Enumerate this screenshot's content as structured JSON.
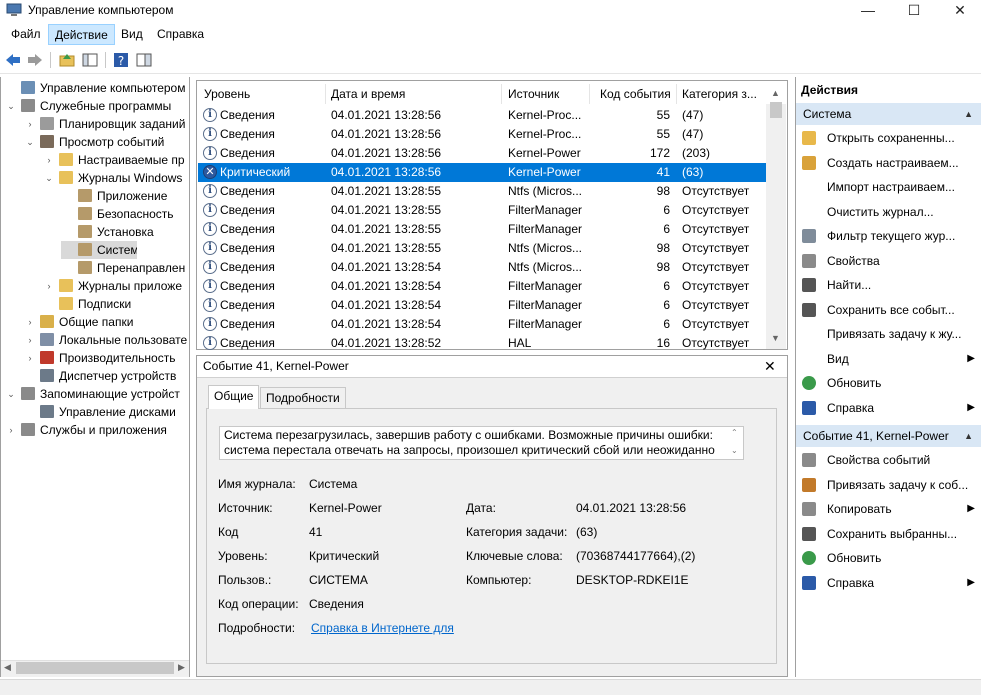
{
  "window": {
    "title": "Управление компьютером",
    "minimize": "—",
    "maximize": "☐",
    "close": "✕"
  },
  "menu": [
    "Файл",
    "Действие",
    "Вид",
    "Справка"
  ],
  "menu_active": "Действие",
  "tree": [
    {
      "label": "Управление компьютером (л",
      "level": 0,
      "exp": "",
      "icon": "computer-management-icon",
      "color": "#6b8fb5"
    },
    {
      "label": "Служебные программы",
      "level": 0,
      "exp": "⌄",
      "icon": "tools-icon",
      "color": "#8a8a8a"
    },
    {
      "label": "Планировщик заданий",
      "level": 1,
      "exp": "›",
      "icon": "task-scheduler-icon",
      "color": "#9b9b9b"
    },
    {
      "label": "Просмотр событий",
      "level": 1,
      "exp": "⌄",
      "icon": "event-viewer-icon",
      "color": "#7a6a5a"
    },
    {
      "label": "Настраиваемые пр",
      "level": 2,
      "exp": "›",
      "icon": "folder-icon",
      "color": "#e8c15a"
    },
    {
      "label": "Журналы Windows",
      "level": 2,
      "exp": "⌄",
      "icon": "folder-icon",
      "color": "#e8c15a"
    },
    {
      "label": "Приложение",
      "level": 3,
      "exp": "",
      "icon": "log-icon",
      "color": "#b59a6a"
    },
    {
      "label": "Безопасность",
      "level": 3,
      "exp": "",
      "icon": "log-icon",
      "color": "#b59a6a"
    },
    {
      "label": "Установка",
      "level": 3,
      "exp": "",
      "icon": "log-icon",
      "color": "#b59a6a"
    },
    {
      "label": "Система",
      "level": 3,
      "exp": "",
      "icon": "log-icon",
      "color": "#b59a6a",
      "selected": true
    },
    {
      "label": "Перенаправлен",
      "level": 3,
      "exp": "",
      "icon": "log-icon",
      "color": "#b59a6a"
    },
    {
      "label": "Журналы приложе",
      "level": 2,
      "exp": "›",
      "icon": "folder-icon",
      "color": "#e8c15a"
    },
    {
      "label": "Подписки",
      "level": 2,
      "exp": "",
      "icon": "subscriptions-icon",
      "color": "#e8c15a"
    },
    {
      "label": "Общие папки",
      "level": 1,
      "exp": "›",
      "icon": "shared-folders-icon",
      "color": "#d9b04a"
    },
    {
      "label": "Локальные пользовате",
      "level": 1,
      "exp": "›",
      "icon": "users-icon",
      "color": "#7f8fa6"
    },
    {
      "label": "Производительность",
      "level": 1,
      "exp": "›",
      "icon": "performance-icon",
      "color": "#c0392b"
    },
    {
      "label": "Диспетчер устройств",
      "level": 1,
      "exp": "",
      "icon": "device-manager-icon",
      "color": "#6c7a89"
    },
    {
      "label": "Запоминающие устройст",
      "level": 0,
      "exp": "⌄",
      "icon": "storage-icon",
      "color": "#8a8a8a"
    },
    {
      "label": "Управление дисками",
      "level": 1,
      "exp": "",
      "icon": "disk-management-icon",
      "color": "#6c7a89"
    },
    {
      "label": "Службы и приложения",
      "level": 0,
      "exp": "›",
      "icon": "services-icon",
      "color": "#8a8a8a"
    }
  ],
  "columns": [
    "Уровень",
    "Дата и время",
    "Источник",
    "Код события",
    "Категория з..."
  ],
  "events": [
    {
      "level": "Сведения",
      "date": "04.01.2021 13:28:56",
      "source": "Kernel-Proc...",
      "code": "55",
      "category": "(47)"
    },
    {
      "level": "Сведения",
      "date": "04.01.2021 13:28:56",
      "source": "Kernel-Proc...",
      "code": "55",
      "category": "(47)"
    },
    {
      "level": "Сведения",
      "date": "04.01.2021 13:28:56",
      "source": "Kernel-Power",
      "code": "172",
      "category": "(203)"
    },
    {
      "level": "Критический",
      "date": "04.01.2021 13:28:56",
      "source": "Kernel-Power",
      "code": "41",
      "category": "(63)",
      "selected": true,
      "critical": true
    },
    {
      "level": "Сведения",
      "date": "04.01.2021 13:28:55",
      "source": "Ntfs (Micros...",
      "code": "98",
      "category": "Отсутствует"
    },
    {
      "level": "Сведения",
      "date": "04.01.2021 13:28:55",
      "source": "FilterManager",
      "code": "6",
      "category": "Отсутствует"
    },
    {
      "level": "Сведения",
      "date": "04.01.2021 13:28:55",
      "source": "FilterManager",
      "code": "6",
      "category": "Отсутствует"
    },
    {
      "level": "Сведения",
      "date": "04.01.2021 13:28:55",
      "source": "Ntfs (Micros...",
      "code": "98",
      "category": "Отсутствует"
    },
    {
      "level": "Сведения",
      "date": "04.01.2021 13:28:54",
      "source": "Ntfs (Micros...",
      "code": "98",
      "category": "Отсутствует"
    },
    {
      "level": "Сведения",
      "date": "04.01.2021 13:28:54",
      "source": "FilterManager",
      "code": "6",
      "category": "Отсутствует"
    },
    {
      "level": "Сведения",
      "date": "04.01.2021 13:28:54",
      "source": "FilterManager",
      "code": "6",
      "category": "Отсутствует"
    },
    {
      "level": "Сведения",
      "date": "04.01.2021 13:28:54",
      "source": "FilterManager",
      "code": "6",
      "category": "Отсутствует"
    },
    {
      "level": "Сведения",
      "date": "04.01.2021 13:28:52",
      "source": "HAL",
      "code": "16",
      "category": "Отсутствует"
    }
  ],
  "detail": {
    "title": "Событие 41, Kernel-Power",
    "close": "✕",
    "tabs": [
      "Общие",
      "Подробности"
    ],
    "message_line1": "Система перезагрузилась, завершив работу с ошибками. Возможные причины ошибки:",
    "message_line2": "система перестала отвечать на запросы, произошел критический сбой или неожиданно",
    "fields": {
      "log_label": "Имя журнала:",
      "log_value": "Система",
      "source_label": "Источник:",
      "source_value": "Kernel-Power",
      "date_label": "Дата:",
      "date_value": "04.01.2021 13:28:56",
      "code_label": "Код",
      "code_value": "41",
      "task_label": "Категория задачи:",
      "task_value": "(63)",
      "level_label": "Уровень:",
      "level_value": "Критический",
      "keywords_label": "Ключевые слова:",
      "keywords_value": "(70368744177664),(2)",
      "user_label": "Пользов.:",
      "user_value": "СИСТЕМА",
      "computer_label": "Компьютер:",
      "computer_value": "DESKTOP-RDKEI1E",
      "opcode_label": "Код операции:",
      "opcode_value": "Сведения",
      "more_label": "Подробности:",
      "more_link": "Справка в Интернете для"
    }
  },
  "actions": {
    "title": "Действия",
    "section1": "Система",
    "items1": [
      {
        "label": "Открыть сохраненны...",
        "icon": "open-folder-icon",
        "color": "#e8b84a",
        "arrow": ""
      },
      {
        "label": "Создать настраиваем...",
        "icon": "filter-create-icon",
        "color": "#d9a23a",
        "arrow": ""
      },
      {
        "label": "Импорт настраиваем...",
        "icon": "",
        "color": "",
        "arrow": ""
      },
      {
        "label": "Очистить журнал...",
        "icon": "",
        "color": "",
        "arrow": ""
      },
      {
        "label": "Фильтр текущего жур...",
        "icon": "filter-icon",
        "color": "#7f8c9a",
        "arrow": ""
      },
      {
        "label": "Свойства",
        "icon": "properties-icon",
        "color": "#8a8a8a",
        "arrow": ""
      },
      {
        "label": "Найти...",
        "icon": "find-icon",
        "color": "#555555",
        "arrow": ""
      },
      {
        "label": "Сохранить все событ...",
        "icon": "save-icon",
        "color": "#555555",
        "arrow": ""
      },
      {
        "label": "Привязать задачу к жу...",
        "icon": "",
        "color": "",
        "arrow": ""
      },
      {
        "label": "Вид",
        "icon": "",
        "color": "",
        "arrow": "▶"
      },
      {
        "label": "Обновить",
        "icon": "refresh-icon",
        "color": "#3a9a4a",
        "arrow": ""
      },
      {
        "label": "Справка",
        "icon": "help-icon",
        "color": "#2b5aa8",
        "arrow": "▶"
      }
    ],
    "section2": "Событие 41, Kernel-Power",
    "items2": [
      {
        "label": "Свойства событий",
        "icon": "event-properties-icon",
        "color": "#8a8a8a",
        "arrow": ""
      },
      {
        "label": "Привязать задачу к соб...",
        "icon": "attach-task-icon",
        "color": "#c27a2a",
        "arrow": ""
      },
      {
        "label": "Копировать",
        "icon": "copy-icon",
        "color": "#8a8a8a",
        "arrow": "▶"
      },
      {
        "label": "Сохранить выбранны...",
        "icon": "save-icon",
        "color": "#555555",
        "arrow": ""
      },
      {
        "label": "Обновить",
        "icon": "refresh-icon",
        "color": "#3a9a4a",
        "arrow": ""
      },
      {
        "label": "Справка",
        "icon": "help-icon",
        "color": "#2b5aa8",
        "arrow": "▶"
      }
    ]
  }
}
